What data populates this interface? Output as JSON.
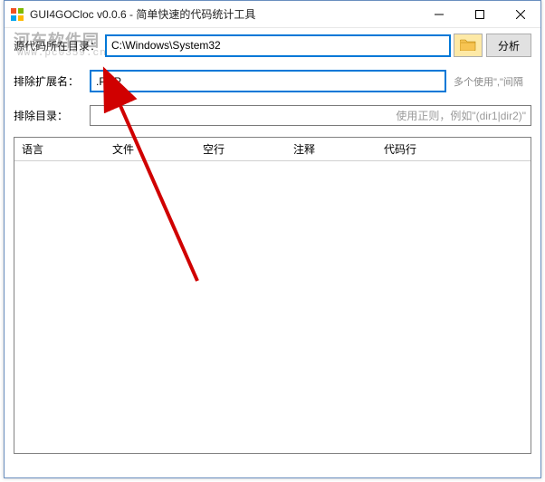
{
  "window": {
    "title": "GUI4GOCloc v0.0.6 - 简单快速的代码统计工具"
  },
  "watermark": {
    "main": "河东软件园",
    "sub": "www.pc0359.cn"
  },
  "row_path": {
    "label": "源代码所在目录：",
    "value": "C:\\Windows\\System32",
    "analyze": "分析"
  },
  "row_ext": {
    "label": "排除扩展名：",
    "value": ".PHP",
    "hint": "多个使用\",\"间隔"
  },
  "row_dir": {
    "label": "排除目录：",
    "placeholder": "使用正则，例如\"(dir1|dir2)\""
  },
  "table": {
    "headers": [
      "语言",
      "文件",
      "空行",
      "注释",
      "代码行"
    ]
  },
  "icons": {
    "folder": "folder-icon"
  }
}
